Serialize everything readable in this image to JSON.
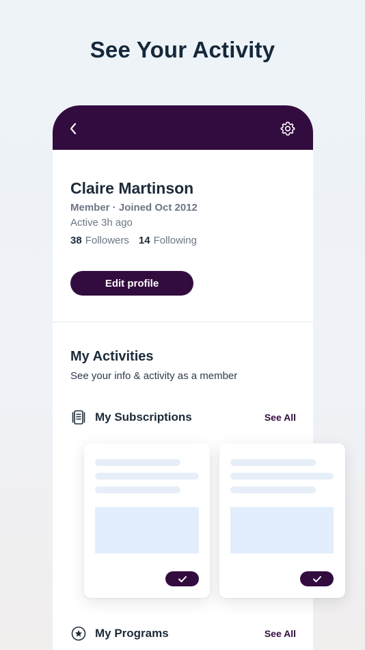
{
  "headline": "See Your Activity",
  "header": {
    "back_icon": "chevron-left-icon",
    "settings_icon": "gear-icon",
    "color": "#330c3f"
  },
  "profile": {
    "name": "Claire Martinson",
    "member_line": "Member · Joined Oct 2012",
    "active": "Active 3h ago",
    "followers_count": "38",
    "followers_label": "Followers",
    "following_count": "14",
    "following_label": "Following",
    "edit_button": "Edit profile"
  },
  "activities": {
    "title": "My Activities",
    "subtitle": "See your info & activity as a member",
    "sections": [
      {
        "label": "My Subscriptions",
        "see_all": "See All",
        "icon": "subscriptions-icon"
      },
      {
        "label": "My Programs",
        "see_all": "See All",
        "icon": "star-circle-icon"
      }
    ]
  },
  "cards": [
    {
      "icon": "check-icon"
    },
    {
      "icon": "check-icon"
    }
  ]
}
